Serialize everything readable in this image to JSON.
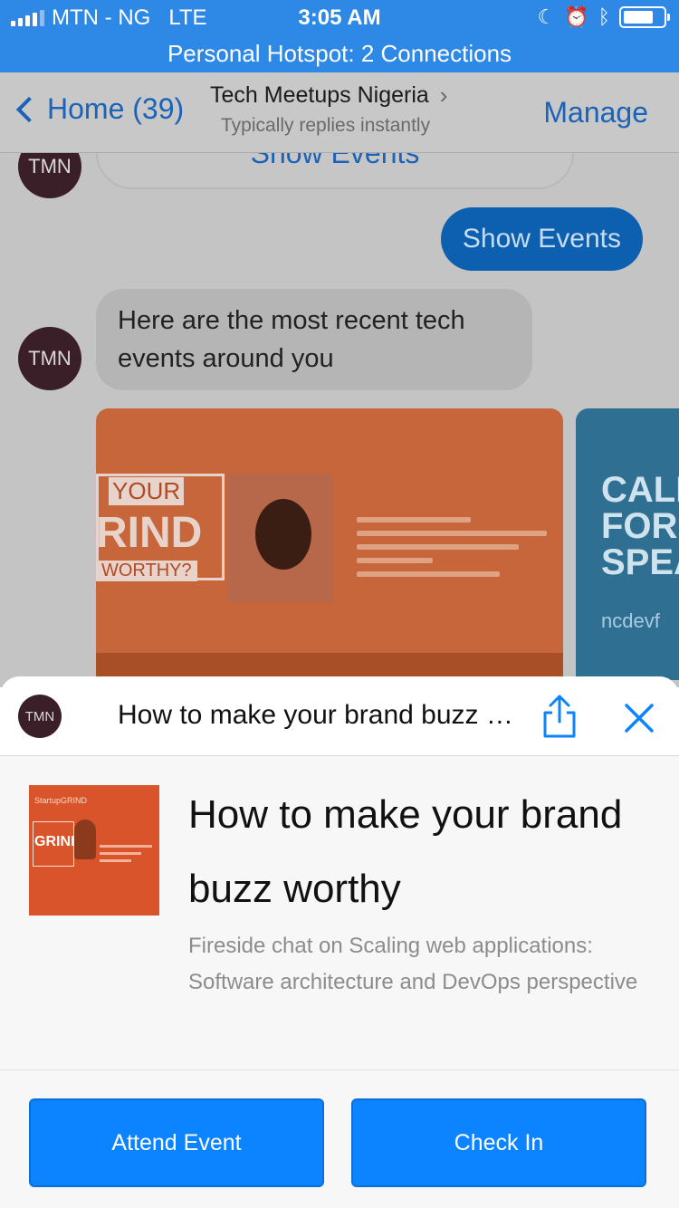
{
  "status_bar": {
    "carrier": "MTN - NG",
    "network": "LTE",
    "time": "3:05 AM",
    "signal_bars": 4,
    "signal_bars_total": 5,
    "battery_level": 0.75
  },
  "hotspot_banner": "Personal Hotspot: 2 Connections",
  "nav": {
    "back_label": "Home (39)",
    "title": "Tech Meetups Nigeria",
    "subtitle": "Typically replies instantly",
    "manage_label": "Manage"
  },
  "chat": {
    "avatar_text": "TMN",
    "top_button_label": "Show Events",
    "user_message": "Show Events",
    "bot_message": "Here are the most recent tech events around you",
    "card1": {
      "word_top": "YOUR",
      "word_mid": "RIND",
      "word_bottom": "WORTHY?"
    },
    "card2": {
      "headline": "CALL FOR SPEA",
      "footer": "ncdevf"
    }
  },
  "sheet": {
    "avatar_text": "TMN",
    "title": "How to make your brand buzz worthy",
    "event_title": "How to make your brand buzz worthy",
    "event_description": "Fireside chat on Scaling web applications: Software architecture and DevOps perspective",
    "thumbnail": {
      "brand": "StartupGRIND",
      "word": "GRIND"
    },
    "attend_label": "Attend Event",
    "checkin_label": "Check In"
  },
  "colors": {
    "status_bar_bg": "#2d88e6",
    "accent_blue": "#0d84ff",
    "nav_link": "#1a63b8",
    "card_orange": "#c7663a"
  },
  "icons": {
    "back": "chevron-left-icon",
    "title_arrow": "chevron-right-icon",
    "share": "share-icon",
    "close": "close-icon",
    "moon": "moon-icon",
    "alarm": "alarm-icon",
    "bluetooth": "bluetooth-icon"
  }
}
